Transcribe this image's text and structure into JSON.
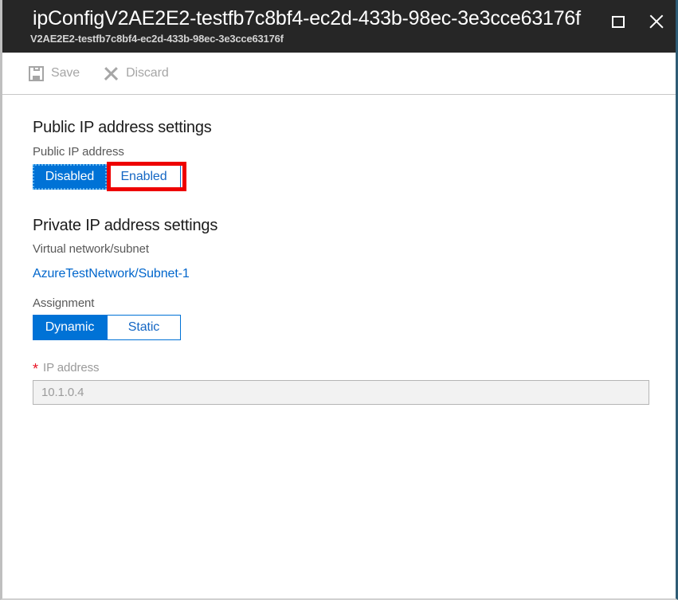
{
  "window": {
    "title": "ipConfigV2AE2E2-testfb7c8bf4-ec2d-433b-98ec-3e3cce63176f",
    "subtitle": "V2AE2E2-testfb7c8bf4-ec2d-433b-98ec-3e3cce63176f",
    "maximize_icon": "maximize-icon",
    "close_icon": "close-icon",
    "header_bg": "#262626"
  },
  "commandbar": {
    "save": {
      "label": "Save",
      "icon": "save-icon",
      "enabled": false
    },
    "discard": {
      "label": "Discard",
      "icon": "discard-icon",
      "enabled": false
    }
  },
  "public_ip": {
    "section_title": "Public IP address settings",
    "field_label": "Public IP address",
    "options": [
      "Disabled",
      "Enabled"
    ],
    "selected": "Disabled",
    "highlighted_option": "Enabled"
  },
  "private_ip": {
    "section_title": "Private IP address settings",
    "vnet_label": "Virtual network/subnet",
    "vnet_value": "AzureTestNetwork/Subnet-1",
    "assignment_label": "Assignment",
    "assignment_options": [
      "Dynamic",
      "Static"
    ],
    "assignment_selected": "Dynamic",
    "ip_required_marker": "*",
    "ip_label": "IP address",
    "ip_value": "10.1.0.4",
    "ip_placeholder": "10.1.0.4"
  },
  "colors": {
    "accent_blue": "#0072d6",
    "link_blue": "#0066cc",
    "annotation_red": "#ee0000",
    "required_red": "#e81123",
    "disabled_grey": "#a6a6a6"
  }
}
